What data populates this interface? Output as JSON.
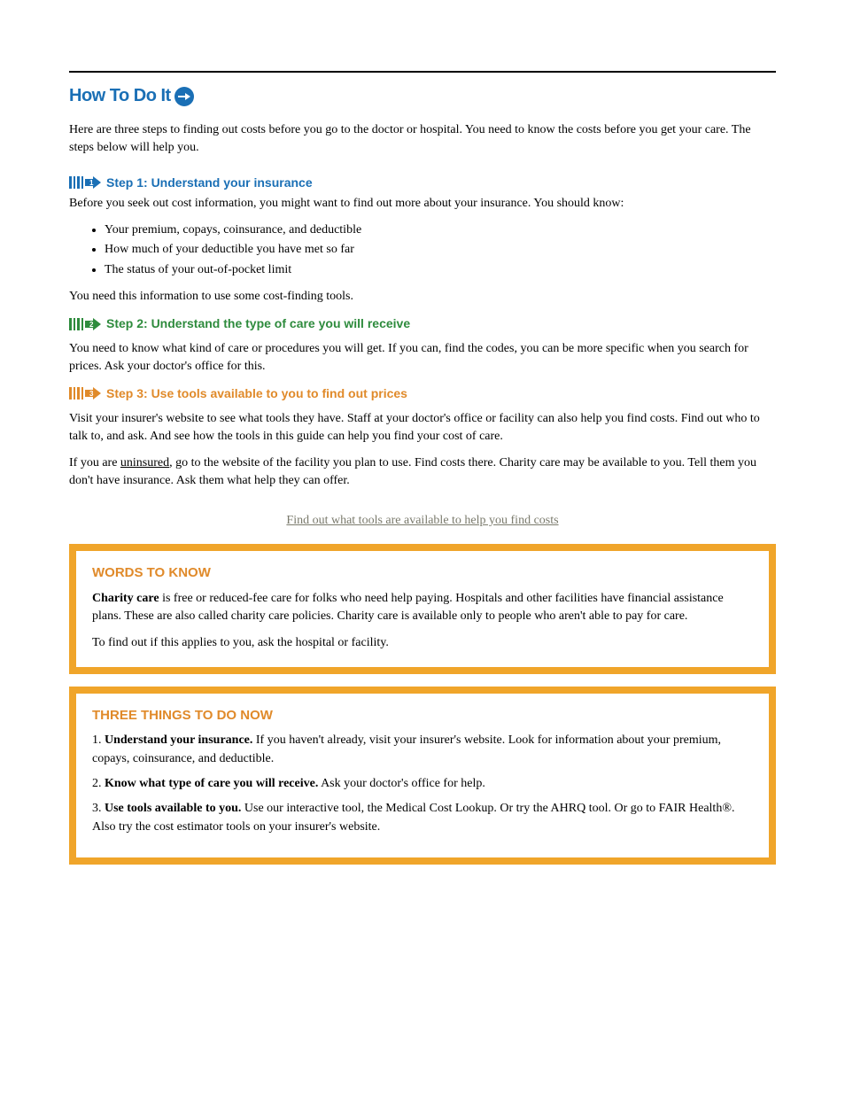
{
  "header": {
    "title": "How To Do It"
  },
  "intro": "Here are three steps to finding out costs before you go to the doctor or hospital. You need to know the costs before you get your care. The steps below will help you.",
  "steps": [
    {
      "label": "Step 1: Understand your insurance",
      "p1": "Before you seek out cost information, you might want to find out more about your insurance. You should know:",
      "items": [
        "Your premium, copays, coinsurance, and deductible",
        "How much of your deductible you have met so far",
        "The status of your out-of-pocket limit"
      ],
      "p2": "You need this information to use some cost-finding tools."
    },
    {
      "label": "Step 2: Understand the type of care you will receive",
      "p1": "You need to know what kind of care or procedures you will get. If you can, find the codes, you can be more specific when you search for prices. Ask your doctor's office for this."
    },
    {
      "label": "Step 3: Use tools available to you to find out prices",
      "p1": "Visit your insurer's website to see what tools they have. Staff at your doctor's office or facility can also help you find costs. Find out who to talk to, and ask. And see how the tools in this guide can help you find your cost of care.",
      "p2_prefix": "If you are ",
      "p2_underline": "uninsured",
      "p2_suffix": ", go to the website of the facility you plan to use. Find costs there. Charity care may be available to you. Tell them you don't have insurance. Ask them what help they can offer."
    }
  ],
  "link": {
    "text": "Find out what tools are available to help you find costs"
  },
  "callouts": [
    {
      "title": "WORDS TO KNOW",
      "p1_bold": "Charity care",
      "p1_rest": " is free or reduced-fee care for folks who need help paying. Hospitals and other facilities have financial assistance plans. These are also called charity care policies. Charity care is available only to people who aren't able to pay for care.",
      "p2": "To find out if this applies to you, ask the hospital or facility."
    },
    {
      "title": "THREE THINGS TO DO NOW",
      "items": [
        {
          "num": "1.",
          "bold": "Understand your insurance.",
          "rest": " If you haven't already, visit your insurer's website. Look for information about your premium, copays, coinsurance, and deductible."
        },
        {
          "num": "2.",
          "bold": "Know what type of care you will receive.",
          "rest": " Ask your doctor's office for help."
        },
        {
          "num": "3.",
          "bold": "Use tools available to you.",
          "rest": " Use our interactive tool, the Medical Cost Lookup. Or try the AHRQ tool. Or go to FAIR Health®. Also try the cost estimator tools on your insurer's website.",
          "reg": true
        }
      ]
    }
  ]
}
